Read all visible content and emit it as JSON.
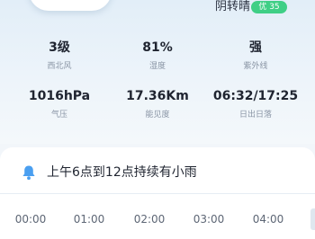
{
  "weather": {
    "condition": "阴转晴",
    "aqi_badge": "优 35"
  },
  "stats": [
    {
      "value": "3级",
      "label": "西北风"
    },
    {
      "value": "81%",
      "label": "湿度"
    },
    {
      "value": "强",
      "label": "紫外线"
    },
    {
      "value": "1016hPa",
      "label": "气压"
    },
    {
      "value": "17.36Km",
      "label": "能见度"
    },
    {
      "value": "06:32/17:25",
      "label": "日出日落"
    }
  ],
  "alert": {
    "icon": "bell-icon",
    "text": "上午6点到12点持续有小雨"
  },
  "hourly": [
    "00:00",
    "01:00",
    "02:00",
    "03:00",
    "04:00"
  ],
  "colors": {
    "accent_blue": "#4a9ff0",
    "aqi_green": "#3fcf86"
  }
}
